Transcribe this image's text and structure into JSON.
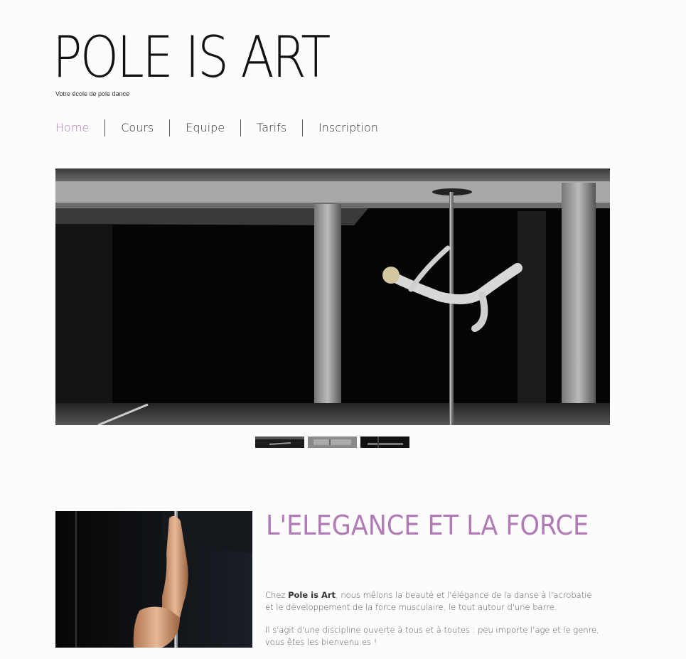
{
  "site": {
    "title": "POLE IS ART",
    "tagline": "Votre école de pole dance"
  },
  "nav": {
    "items": [
      {
        "label": "Home",
        "active": true
      },
      {
        "label": "Cours"
      },
      {
        "label": "Equipe"
      },
      {
        "label": "Tarifs"
      },
      {
        "label": "Inscription"
      }
    ]
  },
  "gallery": {
    "active_index": 0,
    "thumbnail_count": 3
  },
  "section": {
    "title": "L'ELEGANCE ET LA FORCE",
    "para1_pre": "Chez ",
    "para1_bold": "Pole is Art",
    "para1_post": ", nous mêlons la beauté et l'élégance de la danse à l'acrobatie et le développement de la force musculaire, le tout autour d'une barre.",
    "para2": "Il s'agit d'une discipline ouverte à tous et à toutes : peu importe l'age et le genre, vous êtes les bienvenu.es !"
  },
  "colors": {
    "accent": "#b07ab4",
    "text": "#333333",
    "background": "#fcfcfc"
  }
}
